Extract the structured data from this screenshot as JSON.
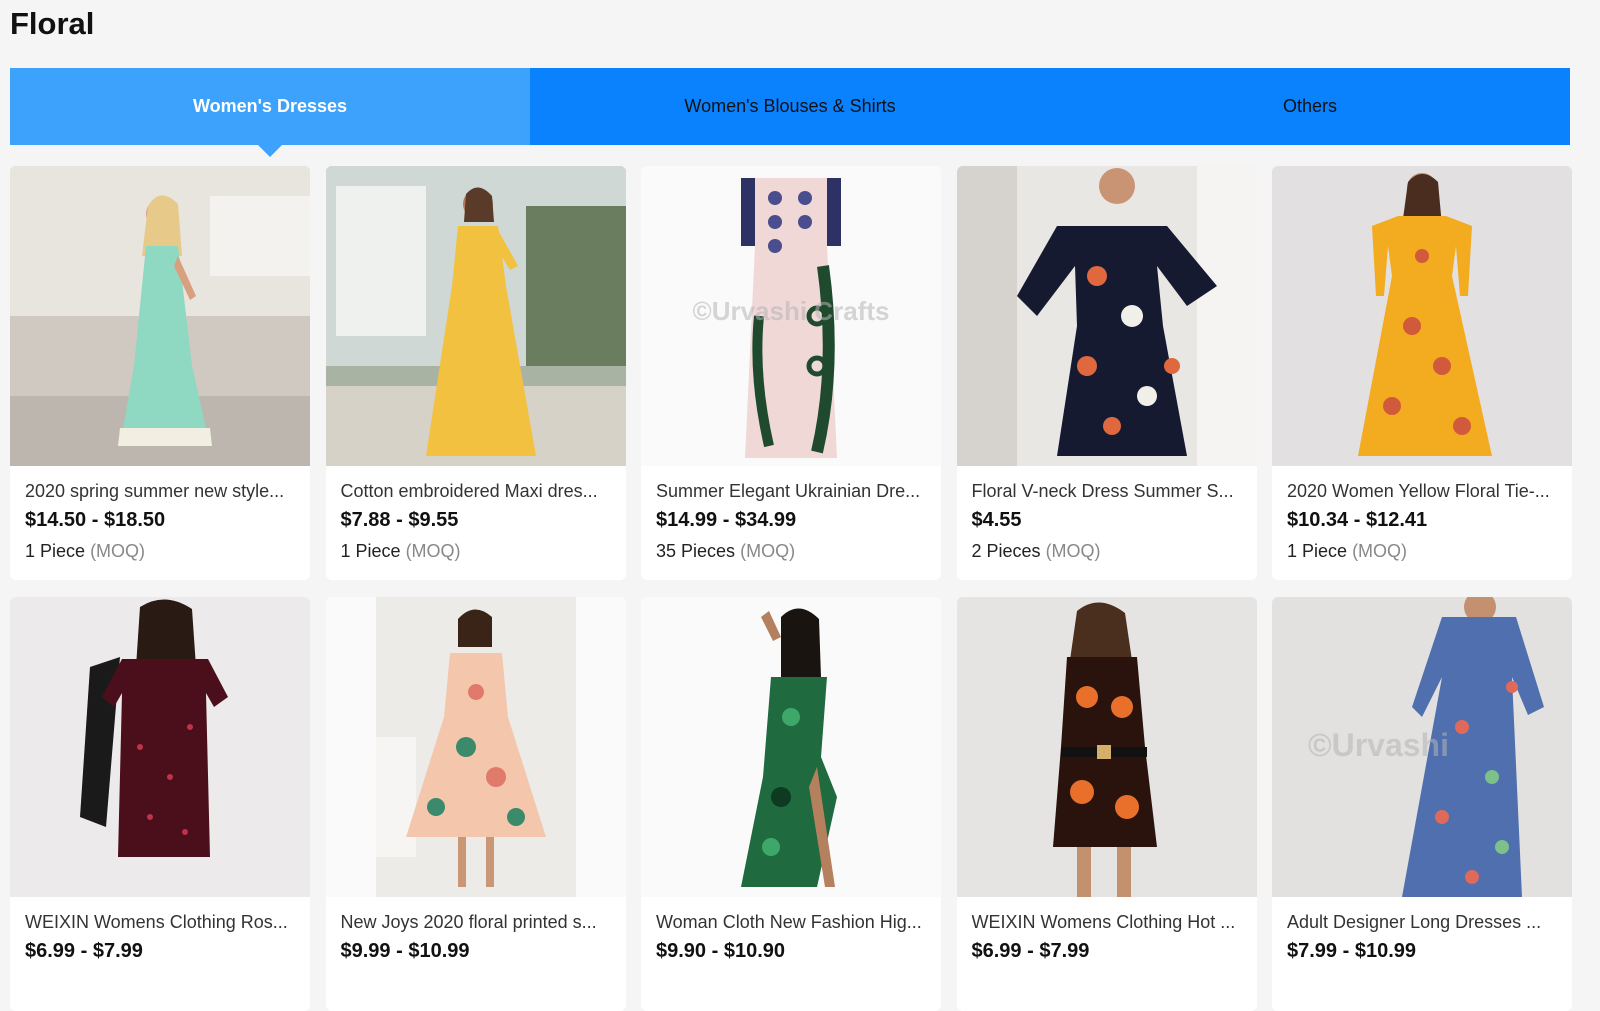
{
  "page": {
    "title": "Floral"
  },
  "tabs": [
    {
      "label": "Women's Dresses",
      "active": true
    },
    {
      "label": "Women's Blouses & Shirts",
      "active": false
    },
    {
      "label": "Others",
      "active": false
    }
  ],
  "colors": {
    "tab_bar": "#0a82fe",
    "tab_active": "#3da2fb",
    "page_bg": "#f5f5f5"
  },
  "products": [
    {
      "title": "2020 spring summer new style...",
      "price": "$14.50 - $18.50",
      "moq_qty": "1 Piece",
      "moq_suffix": "(MOQ)",
      "image": "mint floral spaghetti-strap maxi dress"
    },
    {
      "title": "Cotton embroidered Maxi dres...",
      "price": "$7.88 - $9.55",
      "moq_qty": "1 Piece",
      "moq_suffix": "(MOQ)",
      "image": "yellow wrap maxi dress"
    },
    {
      "title": "Summer Elegant Ukrainian Dre...",
      "price": "$14.99 - $34.99",
      "moq_qty": "35 Pieces",
      "moq_suffix": "(MOQ)",
      "image": "pink kaftan with dark embroidery",
      "watermark": "©Urvashi Crafts"
    },
    {
      "title": "Floral V-neck Dress Summer S...",
      "price": "$4.55",
      "moq_qty": "2 Pieces",
      "moq_suffix": "(MOQ)",
      "image": "navy floral v-neck dress"
    },
    {
      "title": "2020 Women Yellow Floral Tie-...",
      "price": "$10.34 - $12.41",
      "moq_qty": "1 Piece",
      "moq_suffix": "(MOQ)",
      "image": "yellow floral long-sleeve maxi dress"
    },
    {
      "title": "WEIXIN Womens Clothing Ros...",
      "price": "$6.99 - $7.99",
      "moq_qty": "",
      "moq_suffix": "",
      "image": "dark red rose print mini dress"
    },
    {
      "title": "New Joys 2020 floral printed s...",
      "price": "$9.99 - $10.99",
      "moq_qty": "",
      "moq_suffix": "",
      "image": "peach tropical print midi dress"
    },
    {
      "title": "Woman Cloth New Fashion Hig...",
      "price": "$9.90 - $10.90",
      "moq_qty": "",
      "moq_suffix": "",
      "image": "green print strapless slit gown"
    },
    {
      "title": "WEIXIN Womens Clothing Hot ...",
      "price": "$6.99 - $7.99",
      "moq_qty": "",
      "moq_suffix": "",
      "image": "orange sunflower print slip dress"
    },
    {
      "title": "Adult Designer Long Dresses ...",
      "price": "$7.99 - $10.99",
      "moq_qty": "",
      "moq_suffix": "",
      "image": "blue floral wrap maxi dress",
      "watermark": "©Urvashi"
    }
  ]
}
